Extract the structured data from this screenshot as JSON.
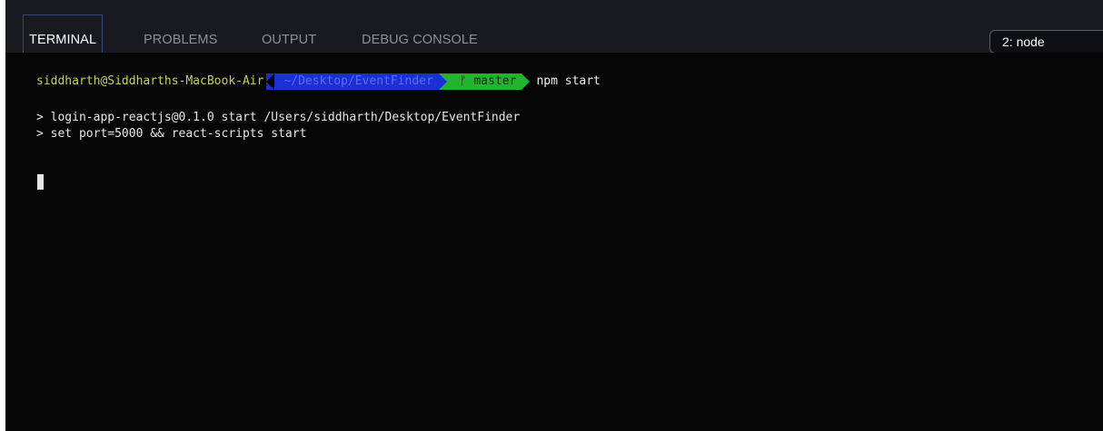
{
  "panel": {
    "tabs": [
      {
        "label": "TERMINAL",
        "active": true
      },
      {
        "label": "PROBLEMS",
        "active": false
      },
      {
        "label": "OUTPUT",
        "active": false
      },
      {
        "label": "DEBUG CONSOLE",
        "active": false
      }
    ],
    "terminal_selector": "2: node"
  },
  "terminal": {
    "prompt": {
      "user_host": "siddharth@Siddharths-MacBook-Air",
      "directory": "~/Desktop/EventFinder",
      "branch_icon": "git-branch-icon",
      "branch": "master",
      "command": "npm start"
    },
    "output": [
      "> login-app-reactjs@0.1.0 start /Users/siddharth/Desktop/EventFinder",
      "> set port=5000 && react-scripts start"
    ]
  },
  "colors": {
    "terminal_bg": "#060606",
    "tabbar_bg": "#181a1f",
    "dir_segment": "#1a2fd6",
    "git_segment": "#23b32f",
    "user_text": "#c9d25a"
  }
}
